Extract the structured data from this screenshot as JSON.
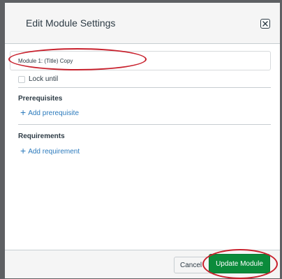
{
  "dialog": {
    "title": "Edit Module Settings",
    "close_icon": "close-icon"
  },
  "module": {
    "name_value": "Module 1: (Title) Copy",
    "lock_label": "Lock until"
  },
  "prerequisites": {
    "title": "Prerequisites",
    "add_label": "Add prerequisite",
    "add_icon": "plus-icon"
  },
  "requirements": {
    "title": "Requirements",
    "add_label": "Add requirement",
    "add_icon": "plus-icon"
  },
  "footer": {
    "cancel_label": "Cancel",
    "update_label": "Update Module"
  },
  "colors": {
    "primary_button": "#0b8b3b",
    "link": "#2b7abc",
    "annotation": "#c8202c"
  }
}
